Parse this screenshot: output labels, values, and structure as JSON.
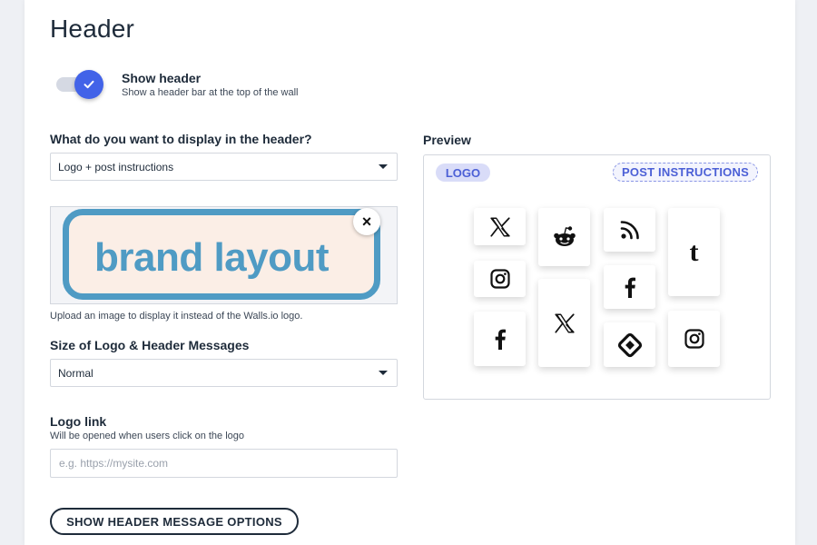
{
  "header": {
    "title": "Header"
  },
  "show_header": {
    "label": "Show header",
    "description": "Show a header bar at the top of the wall",
    "enabled": true
  },
  "display": {
    "label": "What do you want to display in the header?",
    "selected": "Logo + post instructions"
  },
  "logo_upload": {
    "image_text": "brand layout",
    "hint": "Upload an image to display it instead of the Walls.io logo.",
    "remove_label": "×"
  },
  "size": {
    "label": "Size of Logo & Header Messages",
    "selected": "Normal"
  },
  "logo_link": {
    "label": "Logo link",
    "hint": "Will be opened when users click on the logo",
    "placeholder": "e.g. https://mysite.com",
    "value": ""
  },
  "show_options_button": "SHOW HEADER MESSAGE OPTIONS",
  "preview": {
    "title": "Preview",
    "logo_label": "LOGO",
    "instructions_label": "POST INSTRUCTIONS",
    "cards": [
      "x-icon",
      "reddit-icon",
      "rss-icon",
      "tumblr-icon",
      "instagram-icon",
      "facebook-icon",
      "x-icon",
      "facebook-icon",
      "wallsio-icon",
      "instagram-icon"
    ]
  },
  "colors": {
    "accent": "#4263e8",
    "brand_blue": "#4f9bc4",
    "brand_bg": "#fbeee6",
    "pill_bg": "#d9dcf8",
    "pill_text": "#4b5fd6"
  }
}
